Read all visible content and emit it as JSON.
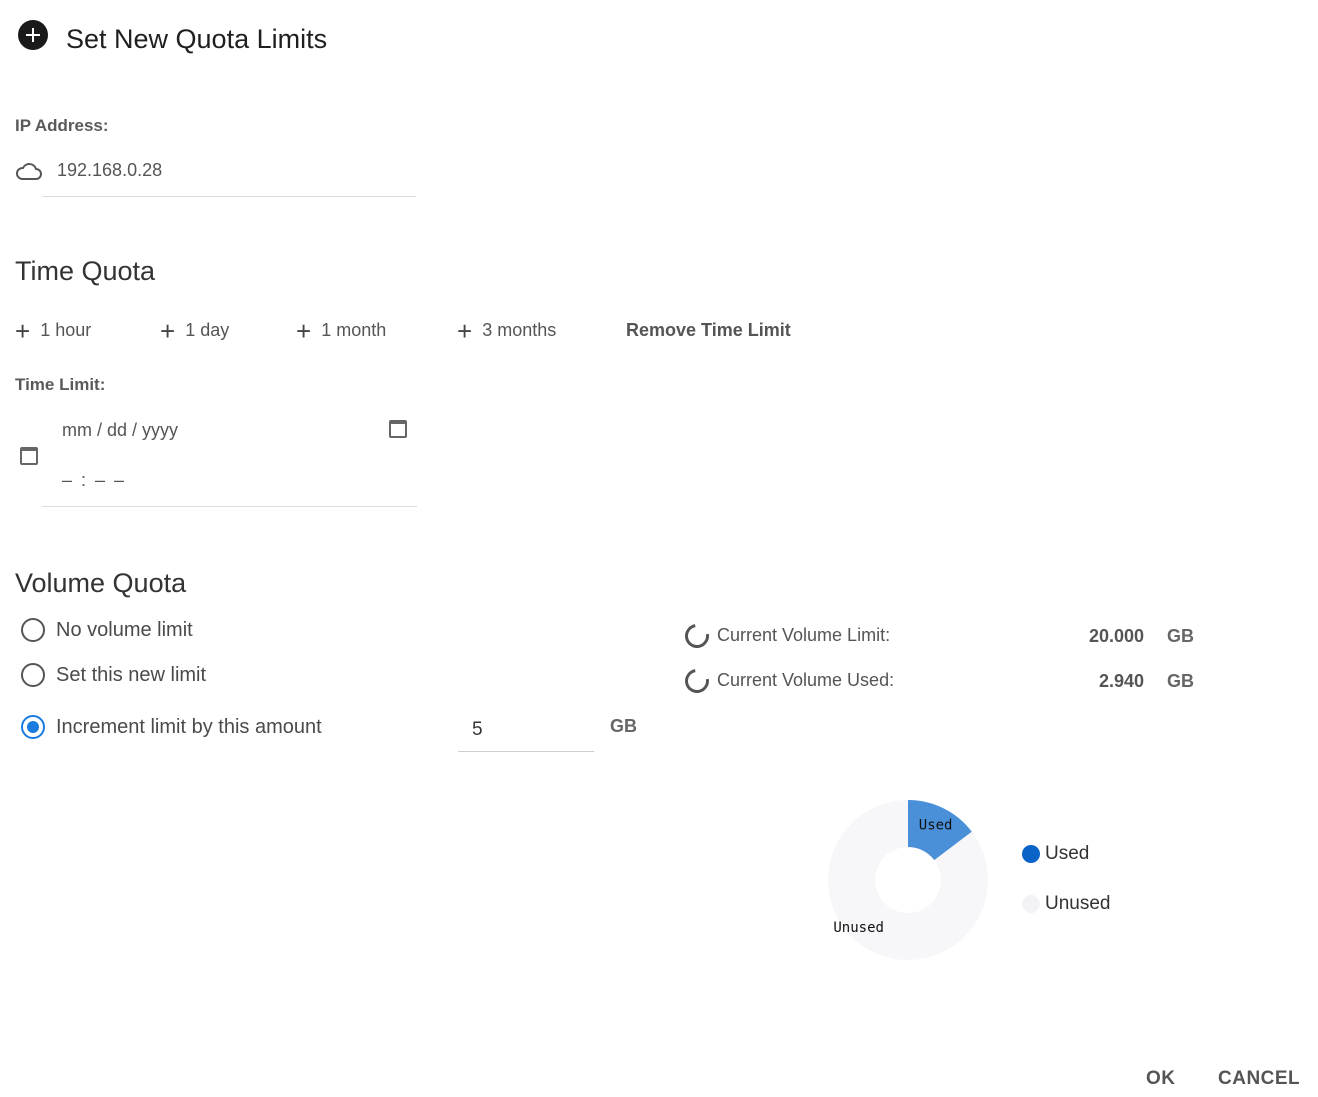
{
  "dialog": {
    "title": "Set New Quota Limits"
  },
  "ip": {
    "label": "IP Address:",
    "value": "192.168.0.28"
  },
  "time_quota": {
    "title": "Time Quota",
    "quick_add": [
      "1 hour",
      "1 day",
      "1 month",
      "3 months"
    ],
    "quick_add_symbol": "+",
    "remove_label": "Remove Time Limit",
    "limit_label": "Time Limit:",
    "date_placeholder": "mm / dd / yyyy",
    "time_placeholder": "– : –  –"
  },
  "volume_quota": {
    "title": "Volume Quota",
    "options": [
      {
        "label": "No volume limit",
        "checked": false
      },
      {
        "label": "Set this new limit",
        "checked": false
      },
      {
        "label": "Increment limit by this amount",
        "checked": true
      }
    ],
    "increment_value": "5",
    "unit": "GB",
    "current_limit_label": "Current Volume Limit:",
    "current_limit_value": "20.000",
    "current_used_label": "Current Volume Used:",
    "current_used_value": "2.940"
  },
  "chart_data": {
    "type": "pie",
    "variant": "donut",
    "categories": [
      "Used",
      "Unused"
    ],
    "values": [
      2.94,
      17.06
    ],
    "colors": [
      "#4a90d9",
      "#f7f6f9"
    ],
    "legend": {
      "placement": "right",
      "colors": [
        "#0a64c8",
        "#f3f2f6"
      ]
    }
  },
  "footer": {
    "ok_label": "OK",
    "cancel_label": "CANCEL"
  }
}
